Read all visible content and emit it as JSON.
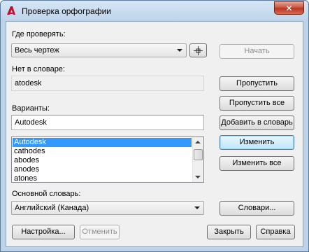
{
  "window": {
    "title": "Проверка орфографии",
    "close_glyph": "✕"
  },
  "check_where": {
    "label": "Где проверять:",
    "value": "Весь чертеж",
    "start_label": "Начать"
  },
  "not_in_dict": {
    "label": "Нет в словаре:",
    "value": "atodesk"
  },
  "suggestions": {
    "label": "Варианты:",
    "value": "Autodesk",
    "items": [
      "Autodesk",
      "cathodes",
      "abodes",
      "anodes",
      "atones"
    ],
    "selected_index": 0
  },
  "buttons": {
    "ignore": "Пропустить",
    "ignore_all": "Пропустить все",
    "add_to_dictionary": "Добавить в словарь",
    "change": "Изменить",
    "change_all": "Изменить все",
    "dictionaries": "Словари...",
    "settings": "Настройка...",
    "undo": "Отменить",
    "close": "Закрыть",
    "help": "Справка"
  },
  "main_dictionary": {
    "label": "Основной словарь:",
    "value": "Английский (Канада)"
  },
  "colors": {
    "selection": "#3399ff",
    "app_icon": "#c8102e"
  }
}
